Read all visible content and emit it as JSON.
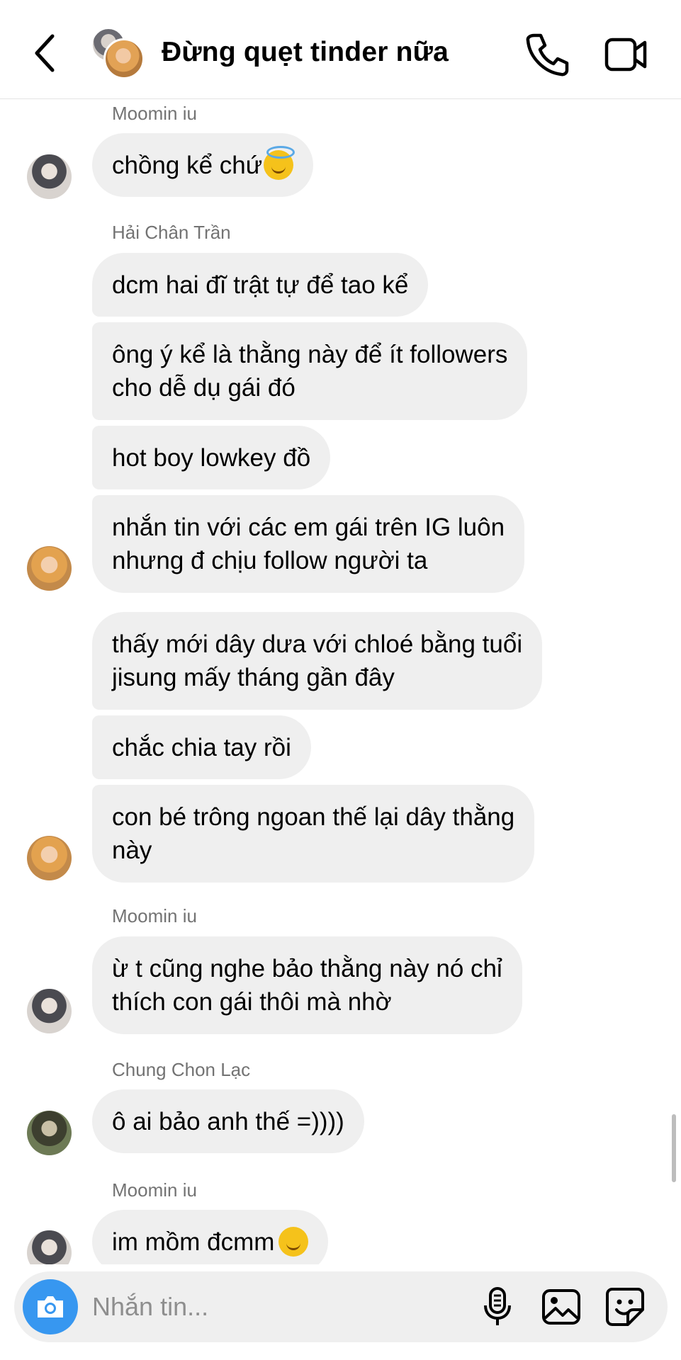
{
  "header": {
    "title": "Đừng quẹt tinder nữa",
    "back_icon": "chevron-left-icon",
    "call_icon": "phone-icon",
    "video_icon": "video-camera-icon"
  },
  "messages": [
    {
      "sender": "Moomin iu",
      "texts": [
        "chồng kể chứ"
      ],
      "emoji": "smiling-face-with-halo"
    },
    {
      "sender": "Hải Chân Trần",
      "texts": [
        "dcm hai đĩ trật tự để tao kể",
        "ông ý kể là thằng này để ít followers\ncho dễ dụ gái đó",
        "hot boy lowkey đồ",
        "nhắn tin với các em gái trên IG luôn\nnhưng đ chịu follow người ta",
        "thấy mới dây dưa với chloé bằng tuổi\njisung mấy tháng gần đây",
        "chắc chia tay rồi",
        "con bé trông ngoan thế lại dây thằng\nnày"
      ]
    },
    {
      "sender": "Moomin iu",
      "texts": [
        "ừ t cũng nghe bảo thằng này nó chỉ\nthích con gái thôi mà nhờ"
      ]
    },
    {
      "sender": "Chung Chon Lạc",
      "texts": [
        "ô ai bảo anh thế =))))"
      ]
    },
    {
      "sender": "Moomin iu",
      "texts": [
        "im mồm đcmm"
      ],
      "emoji": "slightly-smiling-face"
    }
  ],
  "composer": {
    "placeholder": "Nhắn tin...",
    "camera_icon": "camera-icon",
    "mic_icon": "microphone-icon",
    "gallery_icon": "image-icon",
    "sticker_icon": "sticker-icon"
  },
  "colors": {
    "bubble": "#efefef",
    "sender_label": "#737373",
    "camera_button": "#3797f0"
  }
}
